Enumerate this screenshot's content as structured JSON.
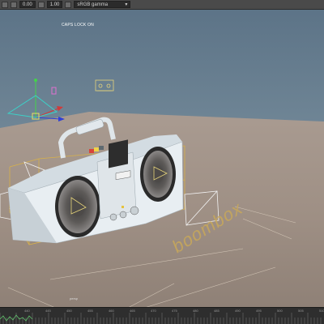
{
  "toolbar": {
    "field_a": "0.00",
    "field_b": "1.00",
    "colorspace": "sRGB gamma"
  },
  "viewport": {
    "caps_lock": "CAPS LOCK ON",
    "camera_name": "persp",
    "ground_text": "boombox"
  },
  "timeline": {
    "frame_labels": [
      "440",
      "445",
      "450",
      "455",
      "460",
      "465",
      "470",
      "475",
      "480",
      "485",
      "490",
      "495",
      "500",
      "505",
      "510"
    ]
  },
  "colors": {
    "sky_top": "#5b7286",
    "sky_bottom": "#7f97a6",
    "floor": "#9e9086",
    "selection": "#d8b14a",
    "boombox_body": "#e6edf2",
    "speaker": "#6e6b6a"
  }
}
